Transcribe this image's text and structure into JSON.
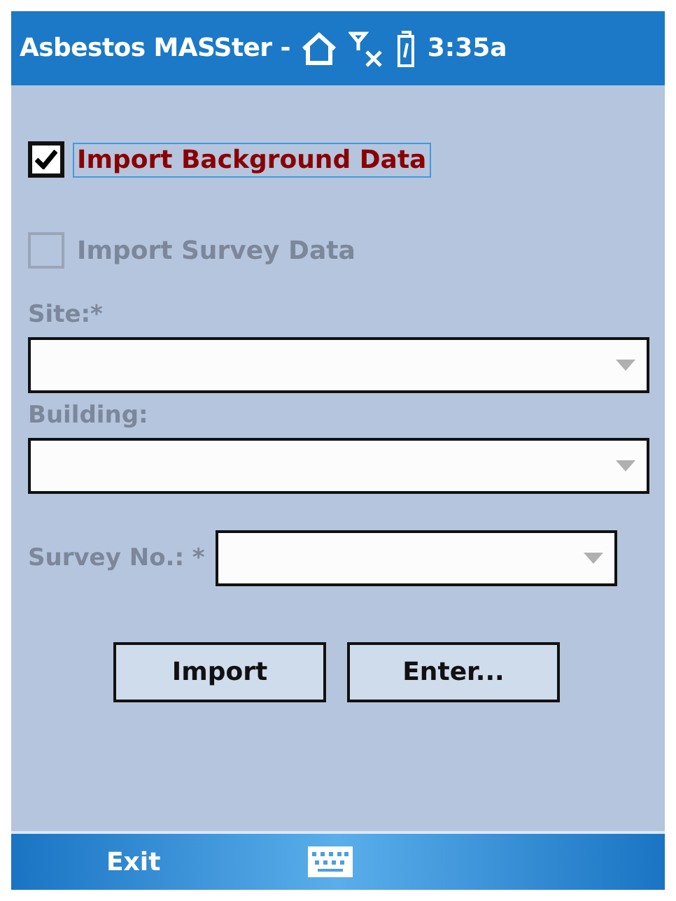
{
  "title_bar": {
    "title": "Asbestos MASSter -",
    "time": "3:35a"
  },
  "options": [
    {
      "label": "Import Background Data",
      "checked": true,
      "disabled": false,
      "focused": true
    },
    {
      "label": "Import Survey Data",
      "checked": false,
      "disabled": true,
      "focused": false
    }
  ],
  "fields": [
    {
      "kind": "stacked",
      "label": "Site:*",
      "disabled": true
    },
    {
      "kind": "stacked",
      "label": "Building:",
      "disabled": true
    },
    {
      "kind": "inline",
      "label": "Survey No.: *",
      "disabled": true
    }
  ],
  "buttons": [
    "Import",
    "Enter..."
  ],
  "menu_bar": {
    "left": "Exit"
  }
}
